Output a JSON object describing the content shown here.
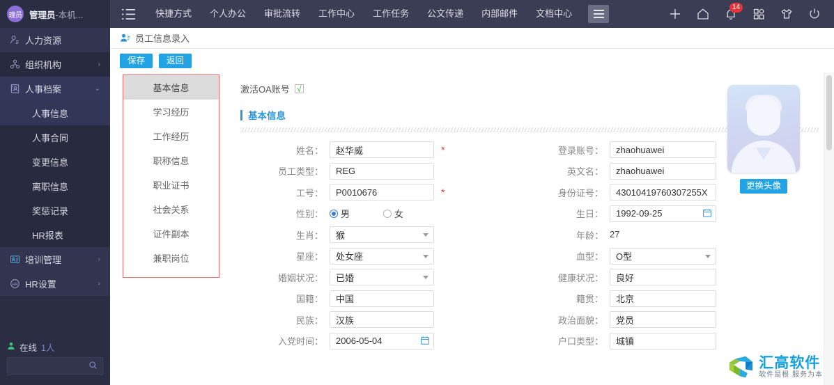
{
  "sidebar": {
    "user": {
      "avatar_text": "理员",
      "name": "管理员",
      "suffix": "-本机..."
    },
    "items": [
      {
        "label": "人力资源",
        "icon": "person-lines-icon",
        "arrow": "",
        "level": 1
      },
      {
        "label": "组织机构",
        "icon": "org-tree-icon",
        "arrow": "›",
        "level": 1
      },
      {
        "label": "人事档案",
        "icon": "file-person-icon",
        "arrow": "⌄",
        "level": 1
      },
      {
        "label": "人事信息",
        "level": 2,
        "active": true
      },
      {
        "label": "人事合同",
        "level": 2
      },
      {
        "label": "变更信息",
        "level": 2
      },
      {
        "label": "离职信息",
        "level": 2
      },
      {
        "label": "奖惩记录",
        "level": 2
      },
      {
        "label": "HR报表",
        "level": 2
      },
      {
        "label": "培训管理",
        "icon": "id-card-icon",
        "arrow": "›",
        "level": 1
      },
      {
        "label": "HR设置",
        "icon": "hr-gear-icon",
        "arrow": "›",
        "level": 1
      }
    ],
    "online_label": "在线",
    "online_count": "1人",
    "search_placeholder": ""
  },
  "topbar": {
    "nav": [
      "快捷方式",
      "个人办公",
      "审批流转",
      "工作中心",
      "工作任务",
      "公文传递",
      "内部邮件",
      "文档中心"
    ],
    "notification_count": "14",
    "icons": [
      "plus-icon",
      "home-icon",
      "bell-icon",
      "apps-grid-icon",
      "shirt-icon",
      "power-icon"
    ]
  },
  "breadcrumb": {
    "icon": "user-card-icon",
    "text": "员工信息录入"
  },
  "toolbar": {
    "save_label": "保存",
    "back_label": "返回"
  },
  "rail": {
    "items": [
      "基本信息",
      "学习经历",
      "工作经历",
      "职称信息",
      "职业证书",
      "社会关系",
      "证件副本",
      "兼职岗位"
    ],
    "active_index": 0
  },
  "form": {
    "oa_label": "激活OA账号",
    "oa_checked": "√",
    "section_title": "基本信息",
    "left_fields": [
      {
        "label": "姓名：",
        "value": "赵华威",
        "type": "input",
        "required": "*"
      },
      {
        "label": "员工类型：",
        "value": "REG",
        "type": "input",
        "required": ""
      },
      {
        "label": "工号：",
        "value": "P0010676",
        "type": "input",
        "required": "*"
      },
      {
        "label": "性别：",
        "type": "radio",
        "options": [
          "男",
          "女"
        ],
        "selected": "男"
      },
      {
        "label": "生肖：",
        "value": "猴",
        "type": "select"
      },
      {
        "label": "星座：",
        "value": "处女座",
        "type": "select"
      },
      {
        "label": "婚姻状况：",
        "value": "已婚",
        "type": "select"
      },
      {
        "label": "国籍：",
        "value": "中国",
        "type": "input"
      },
      {
        "label": "民族：",
        "value": "汉族",
        "type": "input"
      },
      {
        "label": "入党时间：",
        "value": "2006-05-04",
        "type": "date"
      }
    ],
    "right_fields": [
      {
        "label": "登录账号：",
        "value": "zhaohuawei",
        "type": "input"
      },
      {
        "label": "英文名：",
        "value": "zhaohuawei",
        "type": "input"
      },
      {
        "label": "身份证号：",
        "value": "43010419760307255X",
        "type": "input"
      },
      {
        "label": "生日：",
        "value": "1992-09-25",
        "type": "date"
      },
      {
        "label": "年龄：",
        "value": "27",
        "type": "text"
      },
      {
        "label": "血型：",
        "value": "O型",
        "type": "select"
      },
      {
        "label": "健康状况：",
        "value": "良好",
        "type": "input"
      },
      {
        "label": "籍贯：",
        "value": "北京",
        "type": "input"
      },
      {
        "label": "政治面貌：",
        "value": "党员",
        "type": "input"
      },
      {
        "label": "户口类型：",
        "value": "城镇",
        "type": "input"
      }
    ]
  },
  "avatar": {
    "change_label": "更换头像"
  },
  "logo": {
    "name": "汇高软件",
    "tagline": "软件是根  服务为本"
  },
  "colors": {
    "sidebar_bg": "#2b2d42",
    "topbar_bg": "#3b3d54",
    "accent_blue": "#23a3e4",
    "section_blue": "#2f96d8",
    "required_red": "#e6393d",
    "rail_border_red": "#e96a6a",
    "badge_red": "#e8333a",
    "online_green": "#3fbf7f",
    "logo_blue": "#17a0dc"
  }
}
